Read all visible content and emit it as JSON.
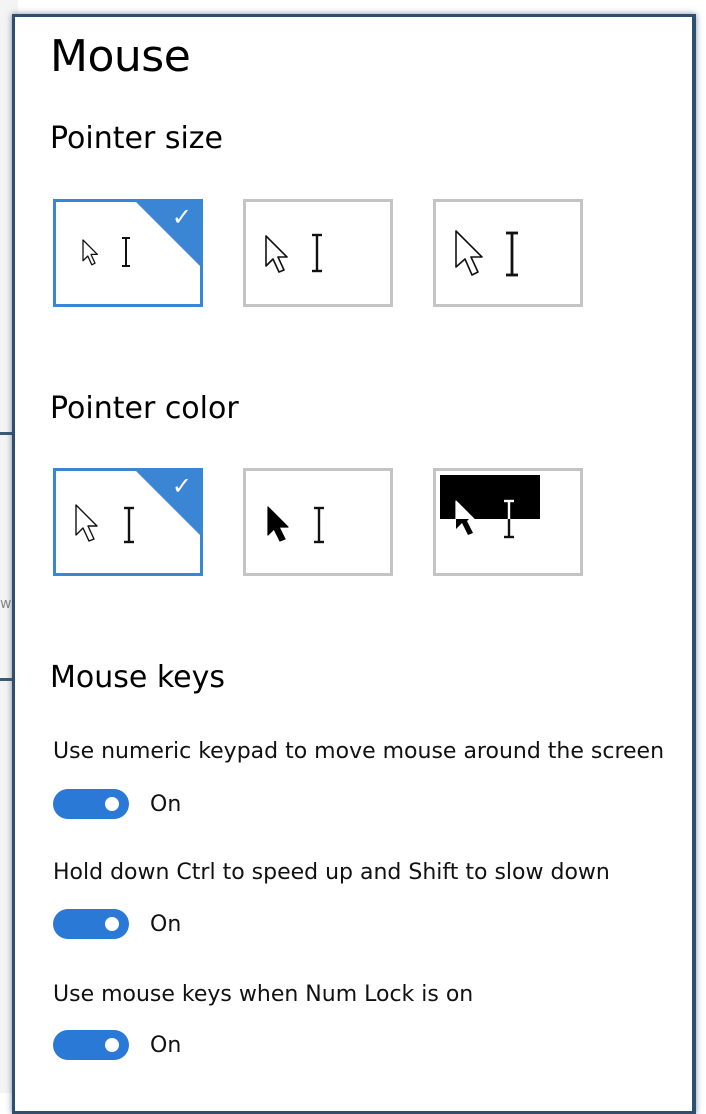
{
  "background_window": {
    "edge_glyph": "w"
  },
  "page": {
    "title": "Mouse"
  },
  "pointer_size": {
    "heading": "Pointer size",
    "options": [
      {
        "name": "small",
        "selected": true
      },
      {
        "name": "medium",
        "selected": false
      },
      {
        "name": "large",
        "selected": false
      }
    ]
  },
  "pointer_color": {
    "heading": "Pointer color",
    "options": [
      {
        "name": "white",
        "selected": true
      },
      {
        "name": "black",
        "selected": false
      },
      {
        "name": "inverted",
        "selected": false
      }
    ]
  },
  "mouse_keys": {
    "heading": "Mouse keys",
    "settings": [
      {
        "description": "Use numeric keypad to move mouse around the screen",
        "state": "On"
      },
      {
        "description": "Hold down Ctrl to speed up and Shift to slow down",
        "state": "On"
      },
      {
        "description": "Use mouse keys when Num Lock is on",
        "state": "On"
      }
    ]
  },
  "colors": {
    "accent": "#3a86d4",
    "toggle_on": "#2b79d6",
    "tile_border": "#c4c4c4",
    "panel_border": "#2f4f6f"
  },
  "icons": {
    "selected_check": "checkmark-icon",
    "arrow_cursor": "arrow-pointer-icon",
    "text_cursor": "text-beam-icon"
  }
}
